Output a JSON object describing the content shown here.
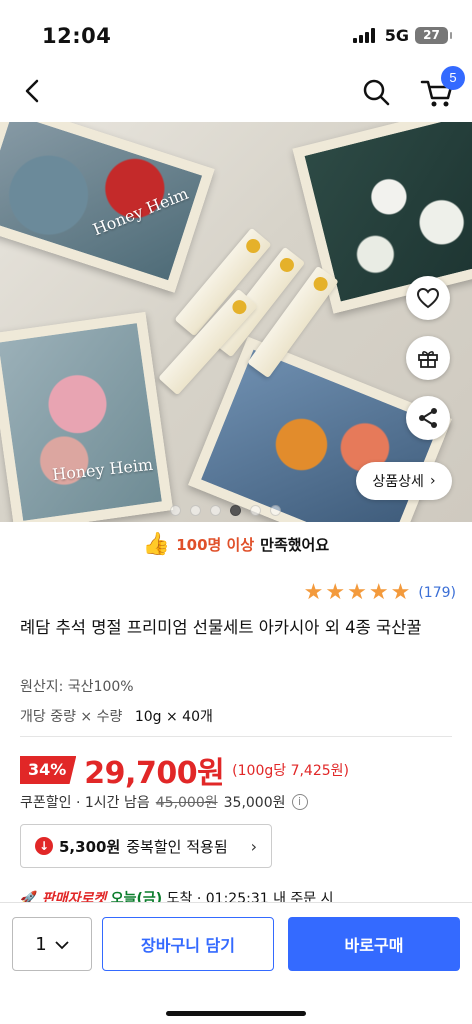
{
  "status_bar": {
    "time": "12:04",
    "network": "5G",
    "battery": "27"
  },
  "nav": {
    "back_icon": "chevron-left-icon",
    "search_icon": "search-icon",
    "cart_icon": "cart-icon",
    "cart_count": "5"
  },
  "hero": {
    "brand_text_1": "Honey Heim",
    "brand_text_2": "Honey Heim",
    "detail_button": "상품상세",
    "slide_index": 4,
    "slide_count": 6
  },
  "satisfaction": {
    "highlight": "100명 이상",
    "rest": "만족했어요"
  },
  "rating": {
    "stars": 5,
    "count": "(179)"
  },
  "product": {
    "title": "례담 추석 명절 프리미엄 선물세트 아카시아 외 4종 국산꿀",
    "origin": "원산지: 국산100%",
    "spec_label": "개당 중량 × 수량",
    "spec_value": "10g × 40개"
  },
  "price": {
    "discount": "34%",
    "price": "29,700원",
    "unit_price": "(100g당 7,425원)",
    "coupon_label": "쿠폰할인 · 1시간 남음",
    "original": "45,000원",
    "coupon_price": "35,000원"
  },
  "dup_discount": {
    "amount": "5,300원",
    "text": "중복할인 적용됨"
  },
  "delivery": {
    "brand": "판매자로켓",
    "today": "오늘(금)",
    "rest": "도착 · 01:25:31 내 주문 시"
  },
  "bottom_bar": {
    "qty": "1",
    "cart_button": "장바구니 담기",
    "buy_button": "바로구매"
  },
  "colors": {
    "accent": "#346aff",
    "sale": "#e12727",
    "star": "#f39a3c"
  }
}
